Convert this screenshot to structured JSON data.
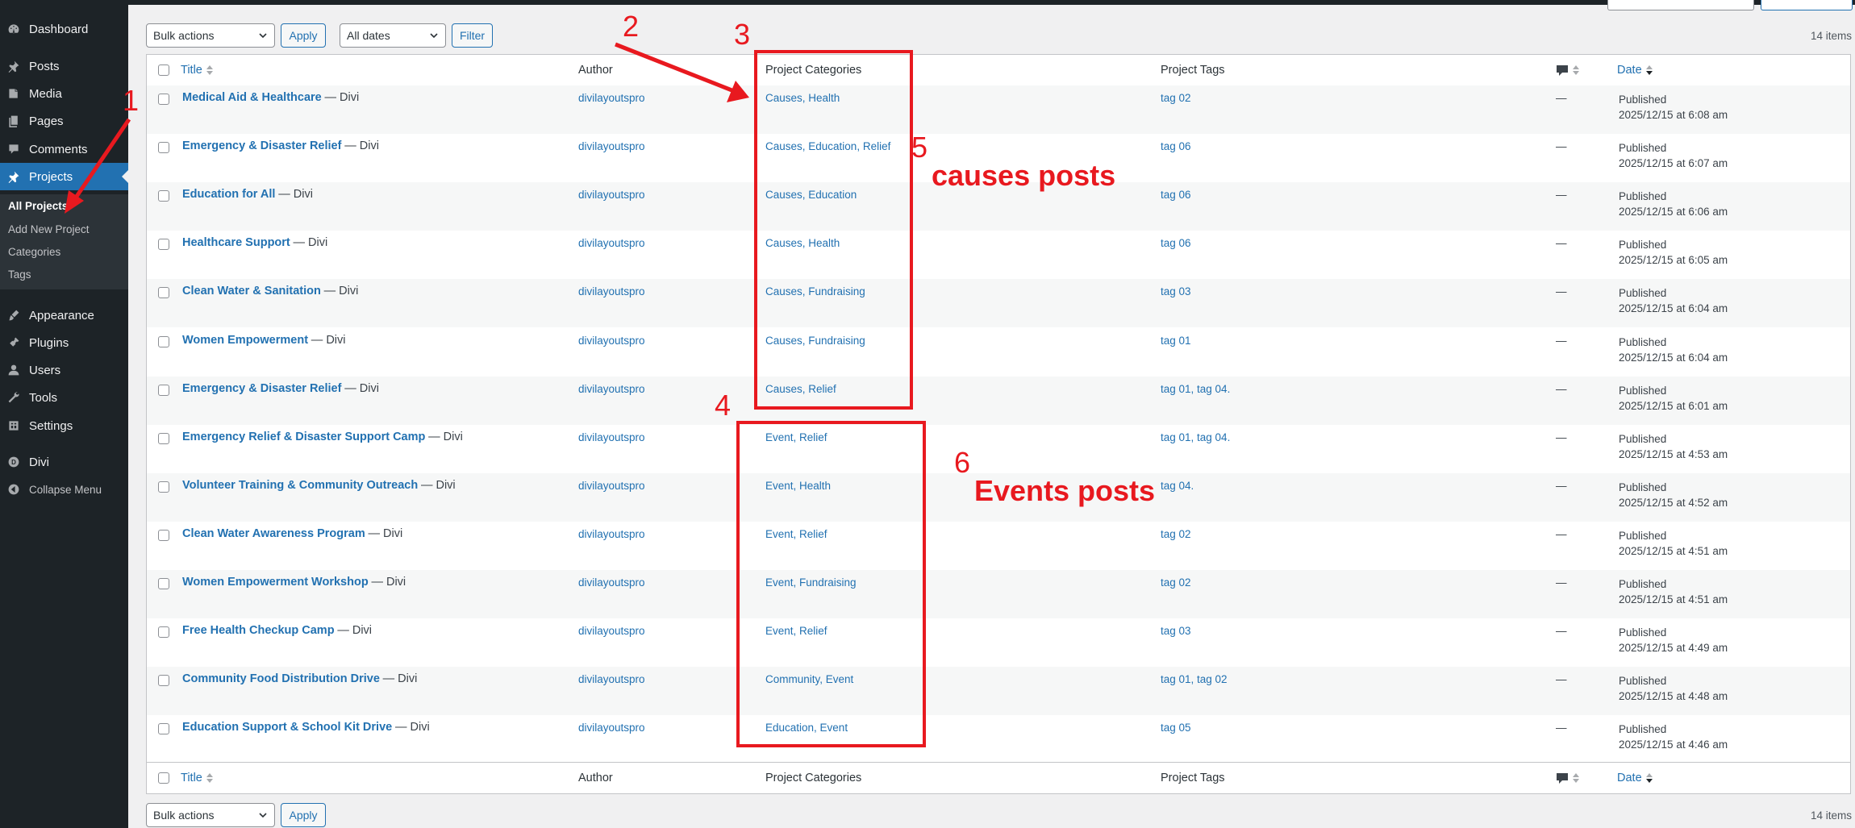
{
  "sidebar": {
    "items": [
      {
        "label": "Dashboard",
        "icon": "dashboard-icon"
      },
      {
        "label": "Posts",
        "icon": "pin-icon"
      },
      {
        "label": "Media",
        "icon": "media-icon"
      },
      {
        "label": "Pages",
        "icon": "pages-icon"
      },
      {
        "label": "Comments",
        "icon": "comment-icon"
      },
      {
        "label": "Projects",
        "icon": "pin-icon"
      },
      {
        "label": "Appearance",
        "icon": "brush-icon"
      },
      {
        "label": "Plugins",
        "icon": "plugin-icon"
      },
      {
        "label": "Users",
        "icon": "user-icon"
      },
      {
        "label": "Tools",
        "icon": "wrench-icon"
      },
      {
        "label": "Settings",
        "icon": "settings-icon"
      },
      {
        "label": "Divi",
        "icon": "divi-logo-icon"
      },
      {
        "label": "Collapse Menu",
        "icon": "collapse-icon"
      }
    ],
    "submenu": [
      "All Projects",
      "Add New Project",
      "Categories",
      "Tags"
    ]
  },
  "toolbar": {
    "bulk_actions": "Bulk actions",
    "apply": "Apply",
    "all_dates": "All dates",
    "filter": "Filter",
    "items_count": "14 items"
  },
  "columns": {
    "title": "Title",
    "author": "Author",
    "categories": "Project Categories",
    "tags": "Project Tags",
    "date": "Date"
  },
  "rows": [
    {
      "title": "Medical Aid & Healthcare",
      "suffix": "— Divi",
      "author": "divilayoutspro",
      "categories": "Causes, Health",
      "tags": "tag 02",
      "comments": "—",
      "status": "Published",
      "date": "2025/12/15 at 6:08 am"
    },
    {
      "title": "Emergency & Disaster Relief",
      "suffix": "— Divi",
      "author": "divilayoutspro",
      "categories": "Causes, Education, Relief",
      "tags": "tag 06",
      "comments": "—",
      "status": "Published",
      "date": "2025/12/15 at 6:07 am"
    },
    {
      "title": "Education for All",
      "suffix": "— Divi",
      "author": "divilayoutspro",
      "categories": "Causes, Education",
      "tags": "tag 06",
      "comments": "—",
      "status": "Published",
      "date": "2025/12/15 at 6:06 am"
    },
    {
      "title": "Healthcare Support",
      "suffix": "— Divi",
      "author": "divilayoutspro",
      "categories": "Causes, Health",
      "tags": "tag 06",
      "comments": "—",
      "status": "Published",
      "date": "2025/12/15 at 6:05 am"
    },
    {
      "title": "Clean Water & Sanitation",
      "suffix": "— Divi",
      "author": "divilayoutspro",
      "categories": "Causes, Fundraising",
      "tags": "tag 03",
      "comments": "—",
      "status": "Published",
      "date": "2025/12/15 at 6:04 am"
    },
    {
      "title": "Women Empowerment",
      "suffix": "— Divi",
      "author": "divilayoutspro",
      "categories": "Causes, Fundraising",
      "tags": "tag 01",
      "comments": "—",
      "status": "Published",
      "date": "2025/12/15 at 6:04 am"
    },
    {
      "title": "Emergency & Disaster Relief",
      "suffix": "— Divi",
      "author": "divilayoutspro",
      "categories": "Causes, Relief",
      "tags": "tag 01, tag 04.",
      "comments": "—",
      "status": "Published",
      "date": "2025/12/15 at 6:01 am"
    },
    {
      "title": "Emergency Relief & Disaster Support Camp",
      "suffix": "— Divi",
      "author": "divilayoutspro",
      "categories": "Event, Relief",
      "tags": "tag 01, tag 04.",
      "comments": "—",
      "status": "Published",
      "date": "2025/12/15 at 4:53 am"
    },
    {
      "title": "Volunteer Training & Community Outreach",
      "suffix": "— Divi",
      "author": "divilayoutspro",
      "categories": "Event, Health",
      "tags": "tag 04.",
      "comments": "—",
      "status": "Published",
      "date": "2025/12/15 at 4:52 am"
    },
    {
      "title": "Clean Water Awareness Program",
      "suffix": "— Divi",
      "author": "divilayoutspro",
      "categories": "Event, Relief",
      "tags": "tag 02",
      "comments": "—",
      "status": "Published",
      "date": "2025/12/15 at 4:51 am"
    },
    {
      "title": "Women Empowerment Workshop",
      "suffix": "— Divi",
      "author": "divilayoutspro",
      "categories": "Event, Fundraising",
      "tags": "tag 02",
      "comments": "—",
      "status": "Published",
      "date": "2025/12/15 at 4:51 am"
    },
    {
      "title": "Free Health Checkup Camp",
      "suffix": "— Divi",
      "author": "divilayoutspro",
      "categories": "Event, Relief",
      "tags": "tag 03",
      "comments": "—",
      "status": "Published",
      "date": "2025/12/15 at 4:49 am"
    },
    {
      "title": "Community Food Distribution Drive",
      "suffix": "— Divi",
      "author": "divilayoutspro",
      "categories": "Community, Event",
      "tags": "tag 01, tag 02",
      "comments": "—",
      "status": "Published",
      "date": "2025/12/15 at 4:48 am"
    },
    {
      "title": "Education Support & School Kit Drive",
      "suffix": "— Divi",
      "author": "divilayoutspro",
      "categories": "Education, Event",
      "tags": "tag 05",
      "comments": "—",
      "status": "Published",
      "date": "2025/12/15 at 4:46 am"
    }
  ],
  "annotations": {
    "n1": "1",
    "n2": "2",
    "n3": "3",
    "n4": "4",
    "n5": "5",
    "n6": "6",
    "causes_label": "causes posts",
    "events_label": "Events posts",
    "color": "#e8191f"
  },
  "colors": {
    "link": "#2271b1",
    "sidebar": "#1d2327",
    "active": "#2271b1"
  }
}
